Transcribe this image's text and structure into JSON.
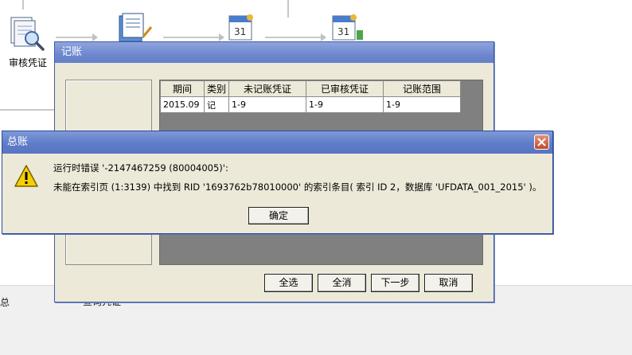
{
  "background": {
    "audit_label": "审核凭证",
    "left_partial_text": "总",
    "query_text": "查询凭证"
  },
  "jizhang": {
    "title": "记账",
    "columns": [
      "期间",
      "类别",
      "未记账凭证",
      "已审核凭证",
      "记账范围"
    ],
    "rows": [
      [
        "2015.09",
        "记",
        "1-9",
        "1-9",
        "1-9"
      ]
    ],
    "buttons": {
      "select_all": "全选",
      "clear_all": "全消",
      "next": "下一步",
      "cancel": "取消"
    }
  },
  "zongzhang": {
    "title": "总账",
    "message_line1": "运行时错误 '-2147467259 (80004005)':",
    "message_line2": "未能在索引页 (1:3139) 中找到 RID '1693762b78010000' 的索引条目( 索引 ID 2，数据库 'UFDATA_001_2015' )。",
    "ok_label": "确定"
  },
  "colors": {
    "title_bar": "#6d87cf",
    "dialog_face": "#ece9d8",
    "grid_background": "#808080",
    "close_button": "#c24a2c",
    "warning_yellow": "#f5d000"
  },
  "icons": [
    "voucher-magnifier-icon",
    "document-pen-icon",
    "calendar-icon",
    "warning-icon",
    "close-icon"
  ]
}
